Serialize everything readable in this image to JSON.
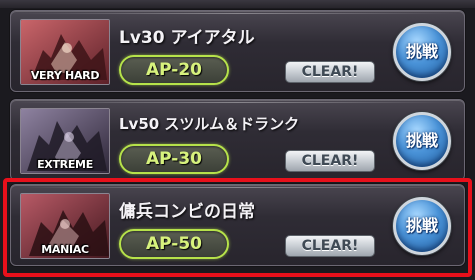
{
  "colors": {
    "selection_frame": "#e8101b",
    "ap_border": "#b6e24a",
    "ap_text": "#d7f27d",
    "challenge_button": "#4a93d8"
  },
  "quests": [
    {
      "difficulty": "VERY HARD",
      "title": "Lv30 アイアタル",
      "ap": "AP-20",
      "clear_label": "CLEAR!",
      "challenge_label": "挑戦",
      "thumb_tint": "#b0484f",
      "thumb_icon": "monster-thumbnail-icon"
    },
    {
      "difficulty": "EXTREME",
      "title": "Lv50 スツルム＆ドランク",
      "ap": "AP-30",
      "clear_label": "CLEAR!",
      "challenge_label": "挑戦",
      "thumb_tint": "#7c6d88",
      "thumb_icon": "monster-thumbnail-icon"
    },
    {
      "difficulty": "MANIAC",
      "title": "傭兵コンビの日常",
      "ap": "AP-50",
      "clear_label": "CLEAR!",
      "challenge_label": "挑戦",
      "thumb_tint": "#a34a55",
      "thumb_icon": "monster-thumbnail-icon",
      "selected": true
    }
  ]
}
